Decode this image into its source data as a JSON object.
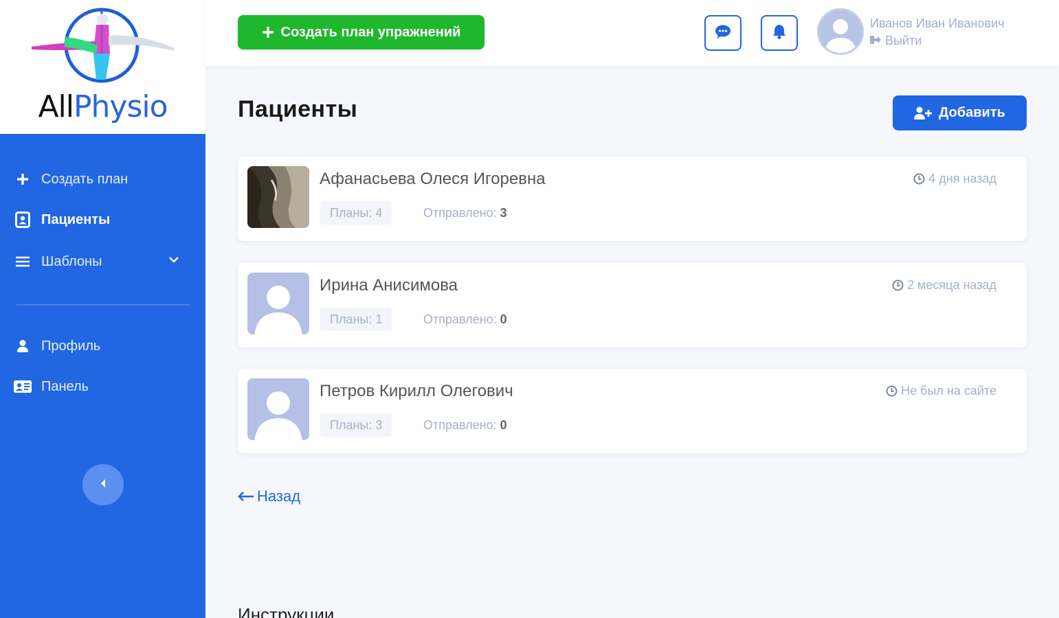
{
  "brand": {
    "part1": "All",
    "part2": "Physio"
  },
  "sidebar": {
    "items": [
      {
        "label": "Создать план",
        "icon": "plus-icon"
      },
      {
        "label": "Пациенты",
        "icon": "contact-book-icon",
        "active": true
      },
      {
        "label": "Шаблоны",
        "icon": "list-icon"
      },
      {
        "label": "Профиль",
        "icon": "user-icon"
      },
      {
        "label": "Панель",
        "icon": "id-card-icon"
      }
    ]
  },
  "header": {
    "create_label": "Создать план упражнений",
    "user_name": "Иванов Иван Иванович",
    "logout_label": "Выйти"
  },
  "main": {
    "title": "Пациенты",
    "add_label": "Добавить",
    "patients": [
      {
        "name": "Афанасьева Олеся Игоревна",
        "plans": "Планы: 4",
        "sent_label": "Отправлено:",
        "sent_count": "3",
        "last_seen": "4 дня назад"
      },
      {
        "name": "Ирина Анисимова",
        "plans": "Планы: 1",
        "sent_label": "Отправлено:",
        "sent_count": "0",
        "last_seen": "2 месяца назад"
      },
      {
        "name": "Петров Кирилл Олегович",
        "plans": "Планы: 3",
        "sent_label": "Отправлено:",
        "sent_count": "0",
        "last_seen": "Не был на сайте"
      }
    ],
    "back_label": "Назад",
    "instructions_title": "Инструкции"
  },
  "colors": {
    "primary": "#2166e3",
    "success": "#1fb72d",
    "muted": "#a6b0c6",
    "background": "#f5f7fc"
  }
}
